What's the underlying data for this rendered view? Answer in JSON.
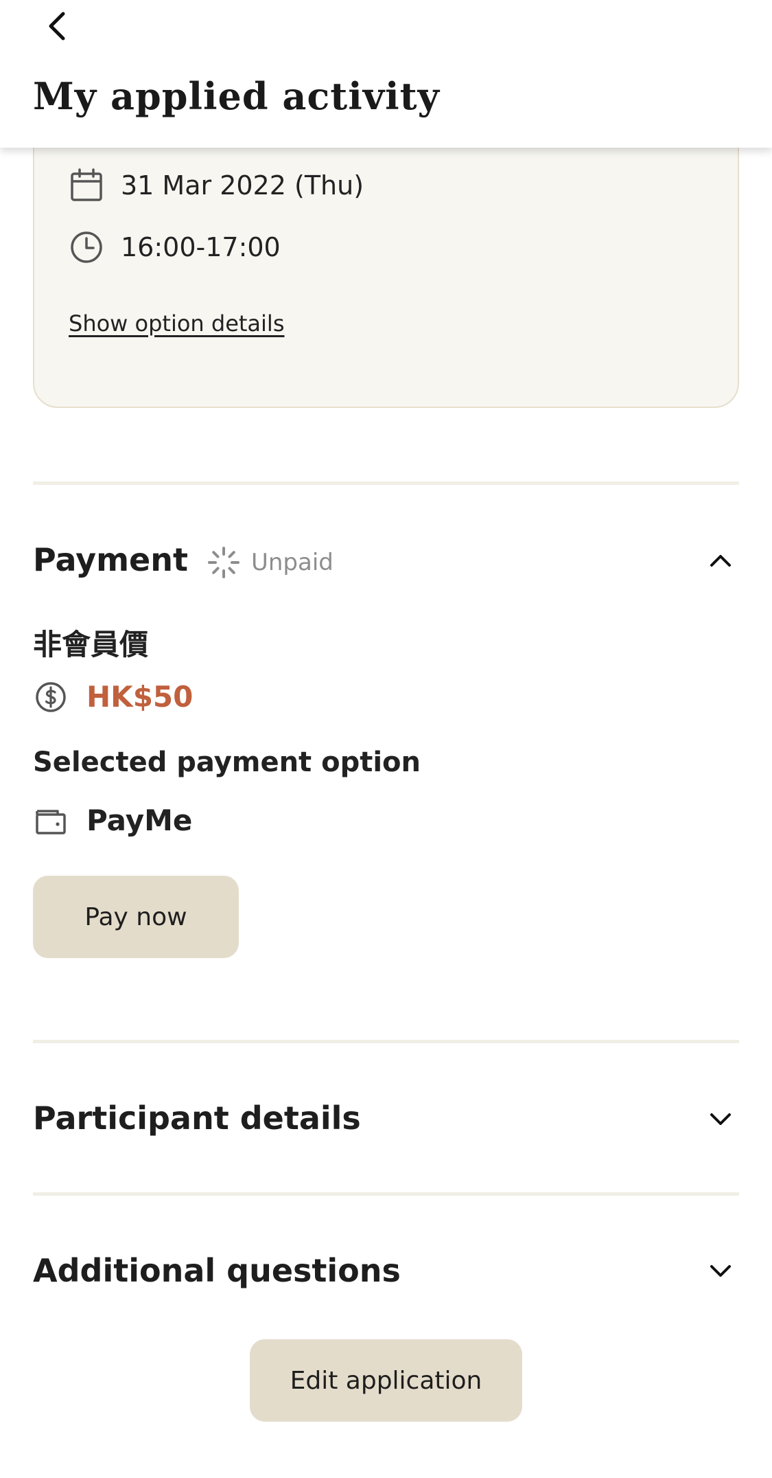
{
  "header": {
    "title": "My applied activity"
  },
  "option": {
    "date": "31 Mar 2022 (Thu)",
    "time": "16:00-17:00",
    "show_details_label": "Show option details"
  },
  "payment": {
    "title": "Payment",
    "status": "Unpaid",
    "price_label": "非會員價",
    "amount": "HK$50",
    "selected_option_label": "Selected payment option",
    "method": "PayMe",
    "pay_button_label": "Pay now"
  },
  "participant": {
    "title": "Participant details"
  },
  "questions": {
    "title": "Additional questions"
  },
  "edit_button_label": "Edit application",
  "colors": {
    "accent_price": "#c0603d",
    "button_bg": "#e4dccb",
    "card_bg": "#f7f6f1",
    "card_border": "#e6dfcc",
    "status_text": "#8d8d8d"
  },
  "icons": {
    "back": "chevron-left-icon",
    "date": "calendar-icon",
    "time": "clock-icon",
    "status": "spinner-icon",
    "collapse": "chevron-up-icon",
    "expand": "chevron-down-icon",
    "price": "dollar-circle-icon",
    "method": "wallet-icon"
  }
}
